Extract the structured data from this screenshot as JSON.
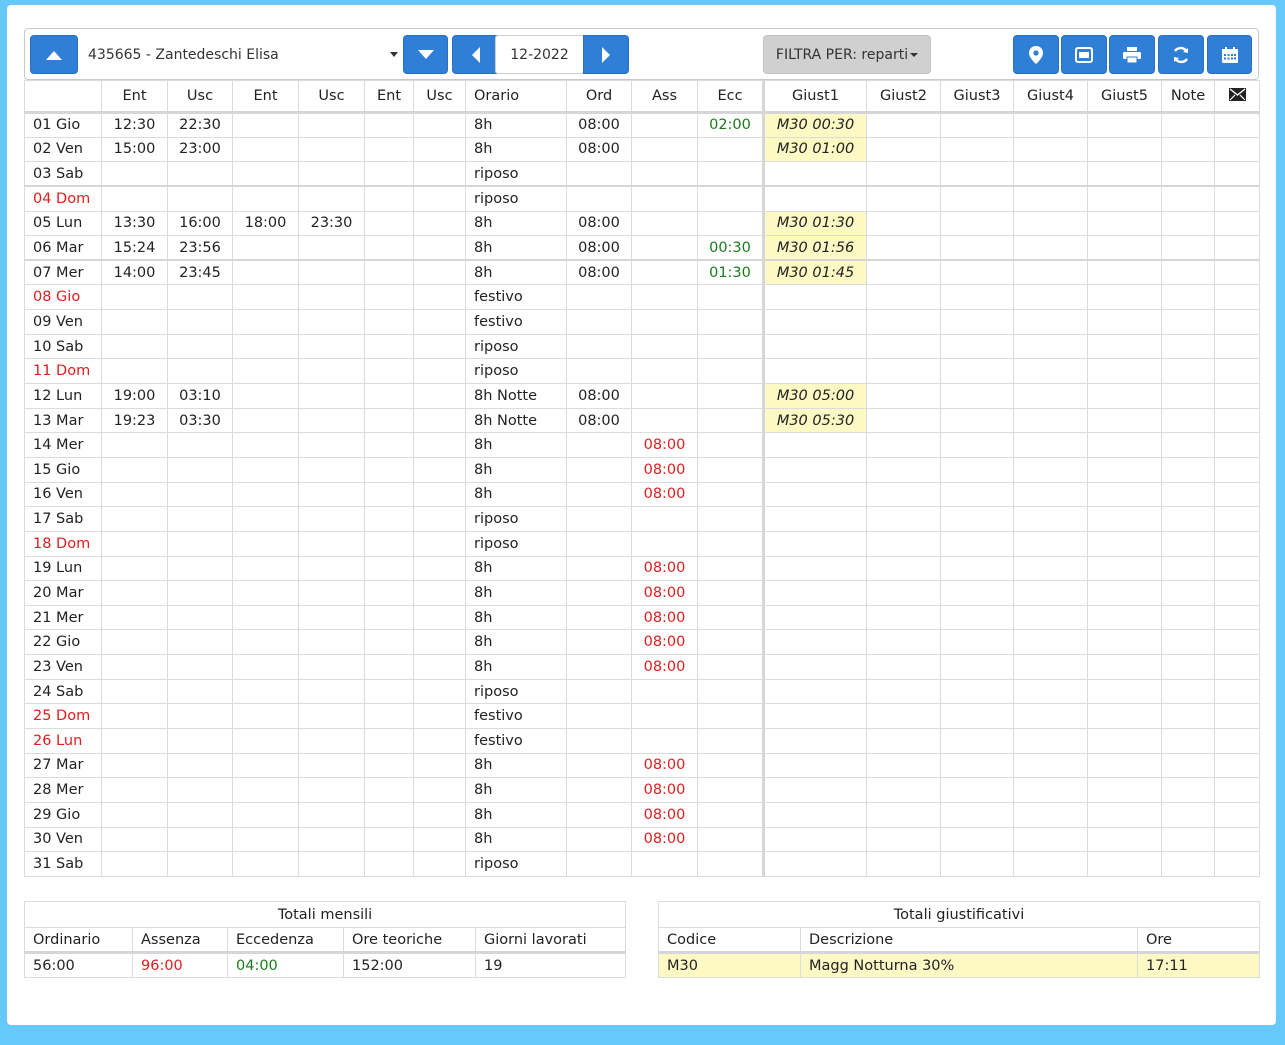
{
  "toolbar": {
    "employee": "435665 - Zantedeschi Elisa",
    "month": "12-2022",
    "filter_label": "FILTRA PER: reparti"
  },
  "grid": {
    "headers": [
      "",
      "Ent",
      "Usc",
      "Ent",
      "Usc",
      "Ent",
      "Usc",
      "Orario",
      "Ord",
      "Ass",
      "Ecc",
      "Giust1",
      "Giust2",
      "Giust3",
      "Giust4",
      "Giust5",
      "Note"
    ],
    "rows": [
      {
        "day": "01 Gio",
        "holiday": false,
        "e1": "12:30",
        "u1": "22:30",
        "e2": "",
        "u2": "",
        "e3": "",
        "u3": "",
        "orario": "8h",
        "ord": "08:00",
        "ass": "",
        "ecc": "02:00",
        "g1": "M30 00:30"
      },
      {
        "day": "02 Ven",
        "holiday": false,
        "e1": "15:00",
        "u1": "23:00",
        "e2": "",
        "u2": "",
        "e3": "",
        "u3": "",
        "orario": "8h",
        "ord": "08:00",
        "ass": "",
        "ecc": "",
        "g1": "M30 01:00"
      },
      {
        "day": "03 Sab",
        "holiday": false,
        "e1": "",
        "u1": "",
        "e2": "",
        "u2": "",
        "e3": "",
        "u3": "",
        "orario": "riposo",
        "ord": "",
        "ass": "",
        "ecc": "",
        "g1": ""
      },
      {
        "day": "04 Dom",
        "holiday": true,
        "e1": "",
        "u1": "",
        "e2": "",
        "u2": "",
        "e3": "",
        "u3": "",
        "orario": "riposo",
        "ord": "",
        "ass": "",
        "ecc": "",
        "g1": ""
      },
      {
        "day": "05 Lun",
        "holiday": false,
        "e1": "13:30",
        "u1": "16:00",
        "e2": "18:00",
        "u2": "23:30",
        "e3": "",
        "u3": "",
        "orario": "8h",
        "ord": "08:00",
        "ass": "",
        "ecc": "",
        "g1": "M30 01:30"
      },
      {
        "day": "06 Mar",
        "holiday": false,
        "e1": "15:24",
        "u1": "23:56",
        "e2": "",
        "u2": "",
        "e3": "",
        "u3": "",
        "orario": "8h",
        "ord": "08:00",
        "ass": "",
        "ecc": "00:30",
        "g1": "M30 01:56"
      },
      {
        "day": "07 Mer",
        "holiday": false,
        "e1": "14:00",
        "u1": "23:45",
        "e2": "",
        "u2": "",
        "e3": "",
        "u3": "",
        "orario": "8h",
        "ord": "08:00",
        "ass": "",
        "ecc": "01:30",
        "g1": "M30 01:45"
      },
      {
        "day": "08 Gio",
        "holiday": true,
        "e1": "",
        "u1": "",
        "e2": "",
        "u2": "",
        "e3": "",
        "u3": "",
        "orario": "festivo",
        "ord": "",
        "ass": "",
        "ecc": "",
        "g1": ""
      },
      {
        "day": "09 Ven",
        "holiday": false,
        "e1": "",
        "u1": "",
        "e2": "",
        "u2": "",
        "e3": "",
        "u3": "",
        "orario": "festivo",
        "ord": "",
        "ass": "",
        "ecc": "",
        "g1": ""
      },
      {
        "day": "10 Sab",
        "holiday": false,
        "e1": "",
        "u1": "",
        "e2": "",
        "u2": "",
        "e3": "",
        "u3": "",
        "orario": "riposo",
        "ord": "",
        "ass": "",
        "ecc": "",
        "g1": ""
      },
      {
        "day": "11 Dom",
        "holiday": true,
        "e1": "",
        "u1": "",
        "e2": "",
        "u2": "",
        "e3": "",
        "u3": "",
        "orario": "riposo",
        "ord": "",
        "ass": "",
        "ecc": "",
        "g1": ""
      },
      {
        "day": "12 Lun",
        "holiday": false,
        "e1": "19:00",
        "u1": "03:10",
        "e2": "",
        "u2": "",
        "e3": "",
        "u3": "",
        "orario": "8h Notte",
        "ord": "08:00",
        "ass": "",
        "ecc": "",
        "g1": "M30 05:00"
      },
      {
        "day": "13 Mar",
        "holiday": false,
        "e1": "19:23",
        "u1": "03:30",
        "e2": "",
        "u2": "",
        "e3": "",
        "u3": "",
        "orario": "8h Notte",
        "ord": "08:00",
        "ass": "",
        "ecc": "",
        "g1": "M30 05:30"
      },
      {
        "day": "14 Mer",
        "holiday": false,
        "e1": "",
        "u1": "",
        "e2": "",
        "u2": "",
        "e3": "",
        "u3": "",
        "orario": "8h",
        "ord": "",
        "ass": "08:00",
        "ecc": "",
        "g1": ""
      },
      {
        "day": "15 Gio",
        "holiday": false,
        "e1": "",
        "u1": "",
        "e2": "",
        "u2": "",
        "e3": "",
        "u3": "",
        "orario": "8h",
        "ord": "",
        "ass": "08:00",
        "ecc": "",
        "g1": ""
      },
      {
        "day": "16 Ven",
        "holiday": false,
        "e1": "",
        "u1": "",
        "e2": "",
        "u2": "",
        "e3": "",
        "u3": "",
        "orario": "8h",
        "ord": "",
        "ass": "08:00",
        "ecc": "",
        "g1": ""
      },
      {
        "day": "17 Sab",
        "holiday": false,
        "e1": "",
        "u1": "",
        "e2": "",
        "u2": "",
        "e3": "",
        "u3": "",
        "orario": "riposo",
        "ord": "",
        "ass": "",
        "ecc": "",
        "g1": ""
      },
      {
        "day": "18 Dom",
        "holiday": true,
        "e1": "",
        "u1": "",
        "e2": "",
        "u2": "",
        "e3": "",
        "u3": "",
        "orario": "riposo",
        "ord": "",
        "ass": "",
        "ecc": "",
        "g1": ""
      },
      {
        "day": "19 Lun",
        "holiday": false,
        "e1": "",
        "u1": "",
        "e2": "",
        "u2": "",
        "e3": "",
        "u3": "",
        "orario": "8h",
        "ord": "",
        "ass": "08:00",
        "ecc": "",
        "g1": ""
      },
      {
        "day": "20 Mar",
        "holiday": false,
        "e1": "",
        "u1": "",
        "e2": "",
        "u2": "",
        "e3": "",
        "u3": "",
        "orario": "8h",
        "ord": "",
        "ass": "08:00",
        "ecc": "",
        "g1": ""
      },
      {
        "day": "21 Mer",
        "holiday": false,
        "e1": "",
        "u1": "",
        "e2": "",
        "u2": "",
        "e3": "",
        "u3": "",
        "orario": "8h",
        "ord": "",
        "ass": "08:00",
        "ecc": "",
        "g1": ""
      },
      {
        "day": "22 Gio",
        "holiday": false,
        "e1": "",
        "u1": "",
        "e2": "",
        "u2": "",
        "e3": "",
        "u3": "",
        "orario": "8h",
        "ord": "",
        "ass": "08:00",
        "ecc": "",
        "g1": ""
      },
      {
        "day": "23 Ven",
        "holiday": false,
        "e1": "",
        "u1": "",
        "e2": "",
        "u2": "",
        "e3": "",
        "u3": "",
        "orario": "8h",
        "ord": "",
        "ass": "08:00",
        "ecc": "",
        "g1": ""
      },
      {
        "day": "24 Sab",
        "holiday": false,
        "e1": "",
        "u1": "",
        "e2": "",
        "u2": "",
        "e3": "",
        "u3": "",
        "orario": "riposo",
        "ord": "",
        "ass": "",
        "ecc": "",
        "g1": ""
      },
      {
        "day": "25 Dom",
        "holiday": true,
        "e1": "",
        "u1": "",
        "e2": "",
        "u2": "",
        "e3": "",
        "u3": "",
        "orario": "festivo",
        "ord": "",
        "ass": "",
        "ecc": "",
        "g1": ""
      },
      {
        "day": "26 Lun",
        "holiday": true,
        "e1": "",
        "u1": "",
        "e2": "",
        "u2": "",
        "e3": "",
        "u3": "",
        "orario": "festivo",
        "ord": "",
        "ass": "",
        "ecc": "",
        "g1": ""
      },
      {
        "day": "27 Mar",
        "holiday": false,
        "e1": "",
        "u1": "",
        "e2": "",
        "u2": "",
        "e3": "",
        "u3": "",
        "orario": "8h",
        "ord": "",
        "ass": "08:00",
        "ecc": "",
        "g1": ""
      },
      {
        "day": "28 Mer",
        "holiday": false,
        "e1": "",
        "u1": "",
        "e2": "",
        "u2": "",
        "e3": "",
        "u3": "",
        "orario": "8h",
        "ord": "",
        "ass": "08:00",
        "ecc": "",
        "g1": ""
      },
      {
        "day": "29 Gio",
        "holiday": false,
        "e1": "",
        "u1": "",
        "e2": "",
        "u2": "",
        "e3": "",
        "u3": "",
        "orario": "8h",
        "ord": "",
        "ass": "08:00",
        "ecc": "",
        "g1": ""
      },
      {
        "day": "30 Ven",
        "holiday": false,
        "e1": "",
        "u1": "",
        "e2": "",
        "u2": "",
        "e3": "",
        "u3": "",
        "orario": "8h",
        "ord": "",
        "ass": "08:00",
        "ecc": "",
        "g1": ""
      },
      {
        "day": "31 Sab",
        "holiday": false,
        "e1": "",
        "u1": "",
        "e2": "",
        "u2": "",
        "e3": "",
        "u3": "",
        "orario": "riposo",
        "ord": "",
        "ass": "",
        "ecc": "",
        "g1": ""
      }
    ]
  },
  "totali_mensili": {
    "title": "Totali mensili",
    "headers": [
      "Ordinario",
      "Assenza",
      "Eccedenza",
      "Ore teoriche",
      "Giorni lavorati"
    ],
    "values": [
      "56:00",
      "96:00",
      "04:00",
      "152:00",
      "19"
    ]
  },
  "totali_giustificativi": {
    "title": "Totali giustificativi",
    "headers": [
      "Codice",
      "Descrizione",
      "Ore"
    ],
    "rows": [
      [
        "M30",
        "Magg Notturna 30%",
        "17:11"
      ]
    ]
  },
  "colors": {
    "background": "#66c8fb",
    "button_blue": "#2f7fd7",
    "holiday_red": "#e11d1d",
    "excess_green": "#1b7a1b",
    "giust_highlight": "#fdf9c5"
  },
  "icons": [
    "up-arrow-icon",
    "down-arrow-icon",
    "prev-arrow-icon",
    "next-arrow-icon",
    "map-marker-icon",
    "badge-card-icon",
    "print-icon",
    "refresh-icon",
    "calendar-icon",
    "envelope-icon"
  ]
}
